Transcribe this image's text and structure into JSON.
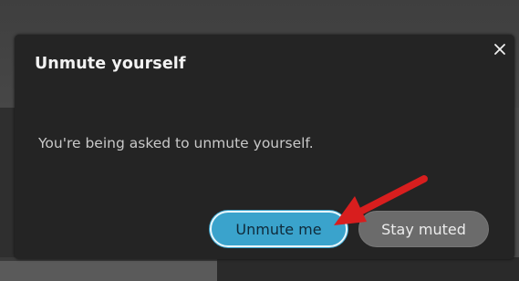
{
  "dialog": {
    "title": "Unmute yourself",
    "message": "You're being asked to unmute yourself.",
    "close_icon": "close-icon",
    "primary_button": "Unmute me",
    "secondary_button": "Stay muted"
  },
  "annotation": {
    "arrow_color": "#d81e1e",
    "arrow_icon": "red-arrow-icon"
  },
  "colors": {
    "dialog_bg": "#242424",
    "primary_button_bg": "#3aa3cc",
    "secondary_button_bg": "#6b6b6b"
  }
}
